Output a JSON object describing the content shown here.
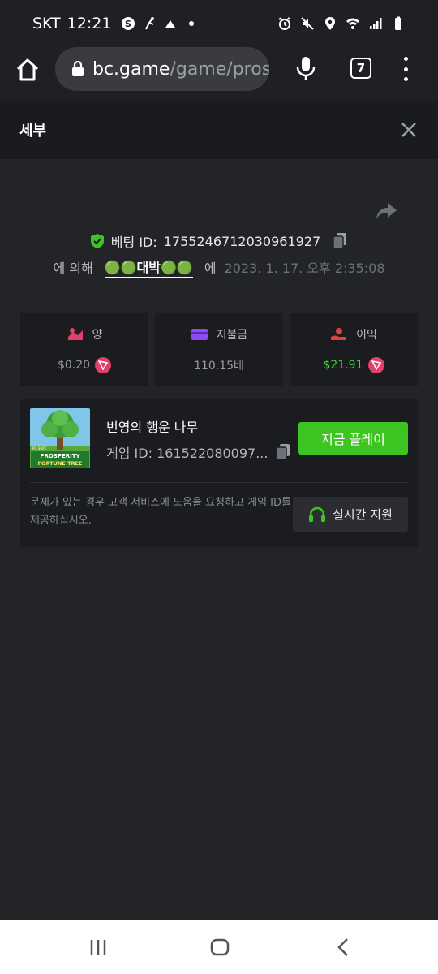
{
  "status": {
    "carrier": "SKT",
    "time": "12:21"
  },
  "browser": {
    "url_domain": "bc.game",
    "url_path": "/game/pros",
    "tab_count": "7"
  },
  "header": {
    "title": "세부"
  },
  "bet": {
    "id_label": "베팅 ID:",
    "id_value": "1755246712030961927",
    "by_prefix": "에 의해",
    "user": "🟢🟢대박🟢🟢",
    "by_suffix": "에",
    "date": "2023. 1. 17. 오후 2:35:08"
  },
  "stats": [
    {
      "label": "양",
      "value": "$0.20",
      "icon": "bet-amount-icon",
      "color": "#e0406a"
    },
    {
      "label": "지불금",
      "value": "110.15배",
      "icon": "payout-card-icon",
      "color": "#8b4cf5"
    },
    {
      "label": "이익",
      "value": "$21.91",
      "icon": "profit-hand-icon",
      "color": "#e04040"
    }
  ],
  "game": {
    "title": "번영의 행운 나무",
    "id_label": "게임 ID:",
    "id_value": "161522080097...",
    "play_label": "지금 플레이",
    "thumb_logo": "PG SOFT",
    "thumb_line1": "PROSPERITY",
    "thumb_line2": "FORTUNE TREE",
    "help_text": "문제가 있는 경우 고객 서비스에 도움을 요청하고 게임 ID를 제공하십시오.",
    "support_label": "실시간 지원"
  },
  "colors": {
    "accent_green": "#3cc521",
    "background": "#232428",
    "card": "#1b1c20"
  }
}
